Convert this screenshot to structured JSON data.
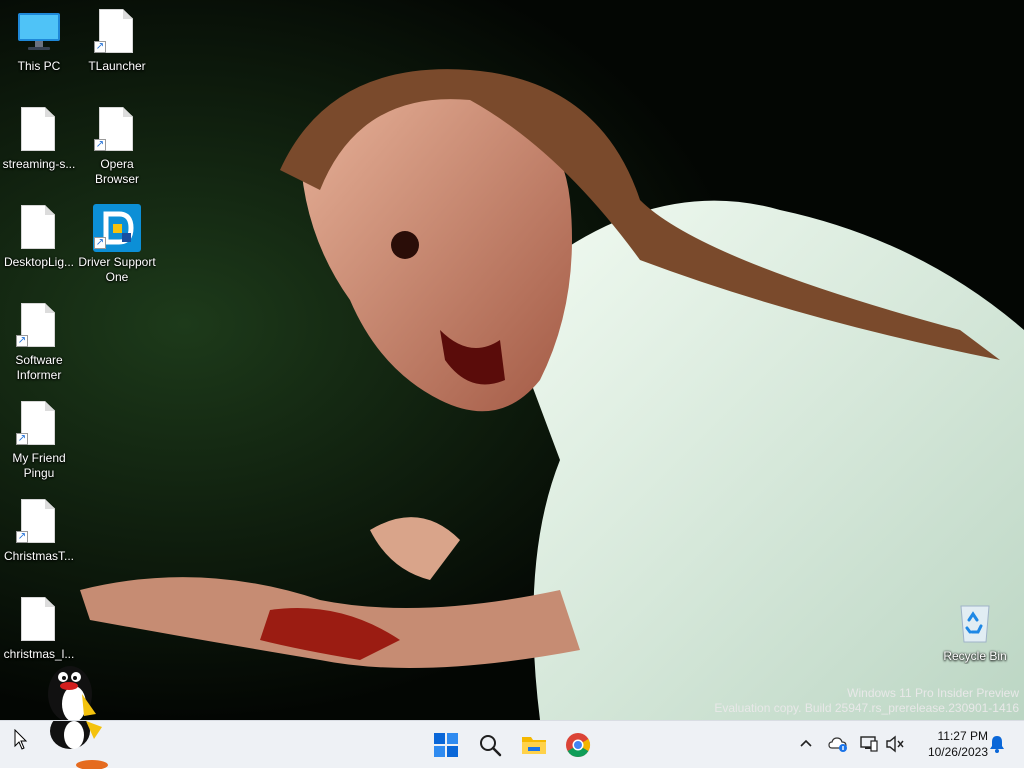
{
  "desktop": {
    "icons": [
      {
        "label": "This PC",
        "icon": "monitor-icon"
      },
      {
        "label": "TLauncher",
        "icon": "document-icon",
        "shortcut": true
      },
      {
        "label": "streaming-s...",
        "icon": "document-icon"
      },
      {
        "label": "Opera Browser",
        "icon": "document-icon",
        "shortcut": true
      },
      {
        "label": "DesktopLig...",
        "icon": "document-icon"
      },
      {
        "label": "Driver Support One",
        "icon": "driver-support-icon",
        "shortcut": true
      },
      {
        "label": "Software Informer",
        "icon": "document-icon",
        "shortcut": true
      },
      {
        "label": "My Friend Pingu",
        "icon": "document-icon",
        "shortcut": true
      },
      {
        "label": "ChristmasT...",
        "icon": "document-icon",
        "shortcut": true
      },
      {
        "label": "christmas_l...",
        "icon": "document-icon"
      },
      {
        "label": "Recycle Bin",
        "icon": "recycle-bin-icon"
      }
    ],
    "watermark": {
      "line1": "Windows 11 Pro Insider Preview",
      "line2": "Evaluation copy. Build 25947.rs_prerelease.230901-1416"
    }
  },
  "taskbar": {
    "apps": [
      {
        "name": "Start",
        "icon": "windows-start-icon"
      },
      {
        "name": "Search",
        "icon": "search-icon"
      },
      {
        "name": "File Explorer",
        "icon": "folder-icon"
      },
      {
        "name": "Google Chrome",
        "icon": "chrome-icon"
      }
    ],
    "tray": {
      "icons": [
        "chevron-up-icon",
        "onedrive-icon",
        "network-icon",
        "volume-muted-icon",
        "notification-bell-icon"
      ]
    },
    "clock": {
      "time": "11:27 PM",
      "date": "10/26/2023"
    }
  },
  "colors": {
    "taskbar_bg": "#eef1f5",
    "accent_blue": "#0a67d8",
    "wallpaper_dark": "#050805"
  }
}
